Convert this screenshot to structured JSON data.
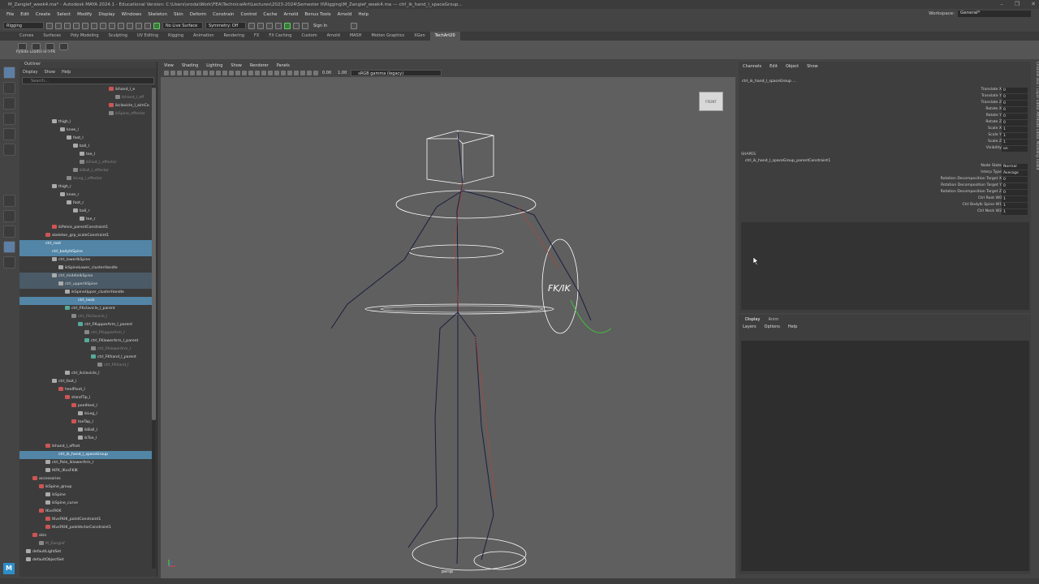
{
  "window": {
    "title": "M_Zangief_week4.ma* - Autodesk MAYA 2024.1 - Educational Version: C:\\Users\\sroda\\Work\\FEA\\TechnicalArt\\Lectures\\2023-2024\\Semester II\\Rigging\\M_Zangief_week4.ma --- ctrl_ik_hand_l_spaceGroup..."
  },
  "menubar": {
    "items": [
      "File",
      "Edit",
      "Create",
      "Select",
      "Modify",
      "Display",
      "Windows",
      "Skeleton",
      "Skin",
      "Deform",
      "Constrain",
      "Control",
      "Cache",
      "Arnold",
      "Bonus Tools",
      "Arnold",
      "Help"
    ],
    "workspace_label": "Workspace:",
    "workspace_value": "General*"
  },
  "statusline": {
    "mode": "Rigging",
    "live_surface": "No Live Surface",
    "symmetry": "Symmetry: Off",
    "sign_in": "Sign In"
  },
  "shelf": {
    "tabs": [
      "Curves",
      "Surfaces",
      "Poly Modeling",
      "Sculpting",
      "UV Editing",
      "Rigging",
      "Animation",
      "Rendering",
      "FX",
      "FX Caching",
      "Custom",
      "Arnold",
      "MASH",
      "Motion Graphics",
      "XGen",
      "TechArt20"
    ],
    "active_tab": "TechArt20",
    "label": "PySide LoadUi Ik->FK"
  },
  "outliner": {
    "title": "Outliner",
    "menu": [
      "Display",
      "Show",
      "Help"
    ],
    "search_placeholder": "Search...",
    "rows": [
      {
        "label": "ikhand_l_e",
        "indent": 110,
        "state": "",
        "icon": "#c55"
      },
      {
        "label": "ikhand_l_eff",
        "indent": 118,
        "state": "dim",
        "icon": "#888"
      },
      {
        "label": "ikclavicle_l_aimCo",
        "indent": 110,
        "state": "",
        "icon": "#c55"
      },
      {
        "label": "ikSpine_effector",
        "indent": 110,
        "state": "dim",
        "icon": "#888"
      },
      {
        "label": "thigh_l",
        "indent": 40,
        "state": "",
        "icon": "#aaa"
      },
      {
        "label": "knee_l",
        "indent": 50,
        "state": "",
        "icon": "#aaa"
      },
      {
        "label": "foot_l",
        "indent": 58,
        "state": "",
        "icon": "#aaa"
      },
      {
        "label": "ball_l",
        "indent": 66,
        "state": "",
        "icon": "#aaa"
      },
      {
        "label": "toe_l",
        "indent": 74,
        "state": "",
        "icon": "#aaa"
      },
      {
        "label": "ikFoot_l_effector",
        "indent": 74,
        "state": "dim",
        "icon": "#888"
      },
      {
        "label": "ikBall_l_effector",
        "indent": 66,
        "state": "dim",
        "icon": "#888"
      },
      {
        "label": "ikLeg_l_effector",
        "indent": 58,
        "state": "dim",
        "icon": "#888"
      },
      {
        "label": "thigh_r",
        "indent": 40,
        "state": "",
        "icon": "#aaa"
      },
      {
        "label": "knee_r",
        "indent": 50,
        "state": "",
        "icon": "#aaa"
      },
      {
        "label": "foot_r",
        "indent": 58,
        "state": "",
        "icon": "#aaa"
      },
      {
        "label": "ball_r",
        "indent": 66,
        "state": "",
        "icon": "#aaa"
      },
      {
        "label": "toe_r",
        "indent": 74,
        "state": "",
        "icon": "#aaa"
      },
      {
        "label": "ikPelvis_parentConstraint1",
        "indent": 40,
        "state": "",
        "icon": "#c55"
      },
      {
        "label": "skeleton_grp_scaleConstraint1",
        "indent": 32,
        "state": "",
        "icon": "#c55"
      },
      {
        "label": "ctrl_root",
        "indent": 24,
        "state": "sel",
        "icon": "#5285a6"
      },
      {
        "label": "ctrl_bodyIkSpine",
        "indent": 32,
        "state": "sel",
        "icon": "#5285a6"
      },
      {
        "label": "ctrl_lowerIkSpine",
        "indent": 40,
        "state": "",
        "icon": "#aaa"
      },
      {
        "label": "ikSpineLower_clusterHandle",
        "indent": 48,
        "state": "",
        "icon": "#aaa"
      },
      {
        "label": "ctrl_middleIkSpine",
        "indent": 40,
        "state": "half",
        "icon": "#aaa"
      },
      {
        "label": "ctrl_upperIkSpine",
        "indent": 48,
        "state": "half",
        "icon": "#aaa"
      },
      {
        "label": "ikSpineUpper_clusterHandle",
        "indent": 56,
        "state": "",
        "icon": "#aaa"
      },
      {
        "label": "ctrl_neck",
        "indent": 64,
        "state": "sel",
        "icon": "#5285a6"
      },
      {
        "label": "ctrl_FKclavicle_l_parent",
        "indent": 56,
        "state": "",
        "icon": "#5a9"
      },
      {
        "label": "ctrl_FKclavicle_l",
        "indent": 64,
        "state": "dim",
        "icon": "#888"
      },
      {
        "label": "ctrl_FKupperArm_l_parent",
        "indent": 72,
        "state": "",
        "icon": "#5a9"
      },
      {
        "label": "ctrl_FKupperArm_l",
        "indent": 80,
        "state": "dim",
        "icon": "#888"
      },
      {
        "label": "ctrl_FKlowerArm_l_parent",
        "indent": 80,
        "state": "",
        "icon": "#5a9"
      },
      {
        "label": "ctrl_FKlowerArm_l",
        "indent": 88,
        "state": "dim",
        "icon": "#888"
      },
      {
        "label": "ctrl_FKhand_l_parent",
        "indent": 88,
        "state": "",
        "icon": "#5a9"
      },
      {
        "label": "ctrl_FKhand_l",
        "indent": 96,
        "state": "dim",
        "icon": "#888"
      },
      {
        "label": "ctrl_ikclavicle_l",
        "indent": 56,
        "state": "",
        "icon": "#aaa"
      },
      {
        "label": "ctrl_foot_l",
        "indent": 40,
        "state": "",
        "icon": "#aaa"
      },
      {
        "label": "heelPivot_l",
        "indent": 48,
        "state": "",
        "icon": "#c55"
      },
      {
        "label": "standTip_l",
        "indent": 56,
        "state": "",
        "icon": "#c55"
      },
      {
        "label": "peelHeel_l",
        "indent": 64,
        "state": "",
        "icon": "#c55"
      },
      {
        "label": "ikLeg_l",
        "indent": 72,
        "state": "",
        "icon": "#aaa"
      },
      {
        "label": "toeTap_l",
        "indent": 64,
        "state": "",
        "icon": "#c55"
      },
      {
        "label": "ikBall_l",
        "indent": 72,
        "state": "",
        "icon": "#aaa"
      },
      {
        "label": "ikToe_l",
        "indent": 72,
        "state": "",
        "icon": "#aaa"
      },
      {
        "label": "ikhand_l_offset",
        "indent": 32,
        "state": "",
        "icon": "#c55"
      },
      {
        "label": "ctrl_ik_hand_l_spaceGroup",
        "indent": 40,
        "state": "sel",
        "icon": "#5285a6"
      },
      {
        "label": "ctrl_Pole_iklowerArm_l",
        "indent": 32,
        "state": "",
        "icon": "#aaa"
      },
      {
        "label": "IKFK_IKvsFKIK",
        "indent": 32,
        "state": "",
        "icon": "#aaa"
      },
      {
        "label": "accessories",
        "indent": 16,
        "state": "",
        "icon": "#c55"
      },
      {
        "label": "ikSpine_group",
        "indent": 24,
        "state": "",
        "icon": "#c55"
      },
      {
        "label": "ikSpine",
        "indent": 32,
        "state": "",
        "icon": "#aaa"
      },
      {
        "label": "ikSpine_curve",
        "indent": 32,
        "state": "",
        "icon": "#aaa"
      },
      {
        "label": "IKvsFKIK",
        "indent": 24,
        "state": "",
        "icon": "#c55"
      },
      {
        "label": "IKvsFKIK_pointConstraint1",
        "indent": 32,
        "state": "",
        "icon": "#c55"
      },
      {
        "label": "IKvsFKIK_poleVectorConstraint1",
        "indent": 32,
        "state": "",
        "icon": "#c55"
      },
      {
        "label": "skin",
        "indent": 16,
        "state": "",
        "icon": "#c55"
      },
      {
        "label": "M_Zangief",
        "indent": 24,
        "state": "dim",
        "icon": "#888"
      },
      {
        "label": "defaultLightSet",
        "indent": 8,
        "state": "",
        "icon": "#aaa"
      },
      {
        "label": "defaultObjectSet",
        "indent": 8,
        "state": "",
        "icon": "#aaa"
      }
    ]
  },
  "viewport": {
    "menu": [
      "View",
      "Shading",
      "Lighting",
      "Show",
      "Renderer",
      "Panels"
    ],
    "exposure": "0.00",
    "gamma": "1.00",
    "colorspace": "sRGB gamma (legacy)",
    "viewcube_label": "FRONT",
    "fk_ik_label": "FK/IK",
    "camera_label": "persp"
  },
  "channelbox": {
    "menu": [
      "Channels",
      "Edit",
      "Object",
      "Show"
    ],
    "object_name": "ctrl_ik_hand_l_spaceGroup ...",
    "attributes": [
      {
        "label": "Translate X",
        "value": "0"
      },
      {
        "label": "Translate Y",
        "value": "0"
      },
      {
        "label": "Translate Z",
        "value": "0"
      },
      {
        "label": "Rotate X",
        "value": "0"
      },
      {
        "label": "Rotate Y",
        "value": "0"
      },
      {
        "label": "Rotate Z",
        "value": "0"
      },
      {
        "label": "Scale X",
        "value": "1"
      },
      {
        "label": "Scale Y",
        "value": "1"
      },
      {
        "label": "Scale Z",
        "value": "1"
      },
      {
        "label": "Visibility",
        "value": "on"
      }
    ],
    "shapes_label": "SHAPES",
    "shape_name": "ctrl_ik_hand_l_spaceGroup_parentConstraint1",
    "shape_attributes": [
      {
        "label": "Node State",
        "value": "Normal"
      },
      {
        "label": "Interp Type",
        "value": "Average"
      },
      {
        "label": "Rotation Decomposition Target X",
        "value": "0"
      },
      {
        "label": "Rotation Decomposition Target Y",
        "value": "0"
      },
      {
        "label": "Rotation Decomposition Target Z",
        "value": "0"
      },
      {
        "label": "Ctrl Root W0",
        "value": "1"
      },
      {
        "label": "Ctrl BodyIk Spine W1",
        "value": "1"
      },
      {
        "label": "Ctrl Neck W2",
        "value": "1"
      }
    ]
  },
  "layers": {
    "tabs": [
      "Display",
      "Anim"
    ],
    "active_tab": "Display",
    "menu": [
      "Layers",
      "Options",
      "Help"
    ]
  },
  "sidetabs": {
    "text": "Channel Box / Layer Editor    Attribute Editor    Modeling Toolkit"
  }
}
